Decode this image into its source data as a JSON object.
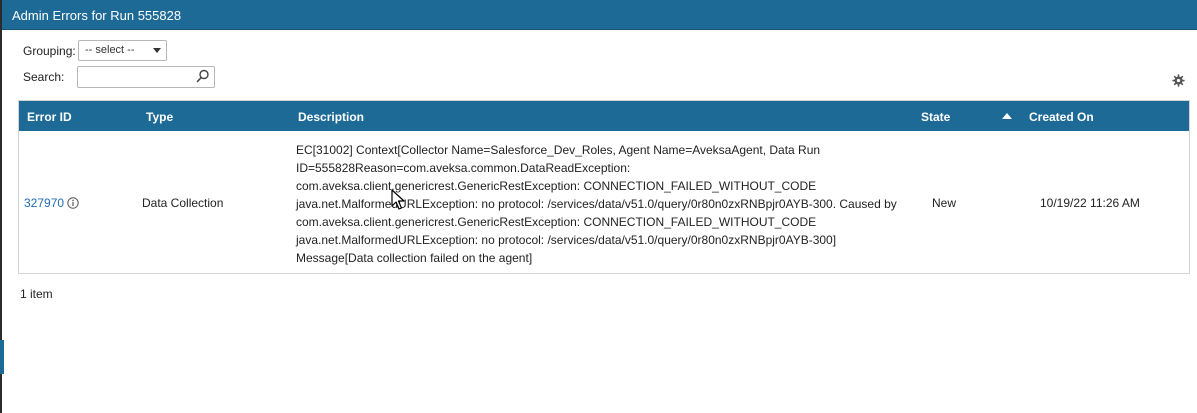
{
  "window": {
    "title": "Admin Errors for Run 555828"
  },
  "toolbar": {
    "grouping_label": "Grouping:",
    "grouping_selected": "-- select --",
    "search_label": "Search:",
    "search_value": ""
  },
  "table": {
    "columns": [
      "Error ID",
      "Type",
      "Description",
      "State",
      "Created On"
    ],
    "rows": [
      {
        "error_id": "327970",
        "type": "Data Collection",
        "description_lines": [
          "EC[31002] Context[Collector Name=Salesforce_Dev_Roles, Agent Name=AveksaAgent, Data Run",
          "ID=555828Reason=com.aveksa.common.DataReadException:",
          "com.aveksa.client.genericrest.GenericRestException: CONNECTION_FAILED_WITHOUT_CODE",
          "java.net.MalformedURLException: no protocol: /services/data/v51.0/query/0r80n0zxRNBpjr0AYB-300. Caused by",
          "com.aveksa.client.genericrest.GenericRestException: CONNECTION_FAILED_WITHOUT_CODE",
          "java.net.MalformedURLException: no protocol: /services/data/v51.0/query/0r80n0zxRNBpjr0AYB-300]",
          "Message[Data collection failed on the agent]"
        ],
        "state": "New",
        "created_on": "10/19/22 11:26 AM"
      }
    ]
  },
  "footer": {
    "item_count": "1 item"
  },
  "colors": {
    "header_blue": "#1d6a96",
    "link_blue": "#1f6bb0"
  },
  "icons": {
    "search": "search-icon",
    "settings": "gear-icon",
    "info": "info-icon",
    "sort": "sort-ascending-icon"
  }
}
